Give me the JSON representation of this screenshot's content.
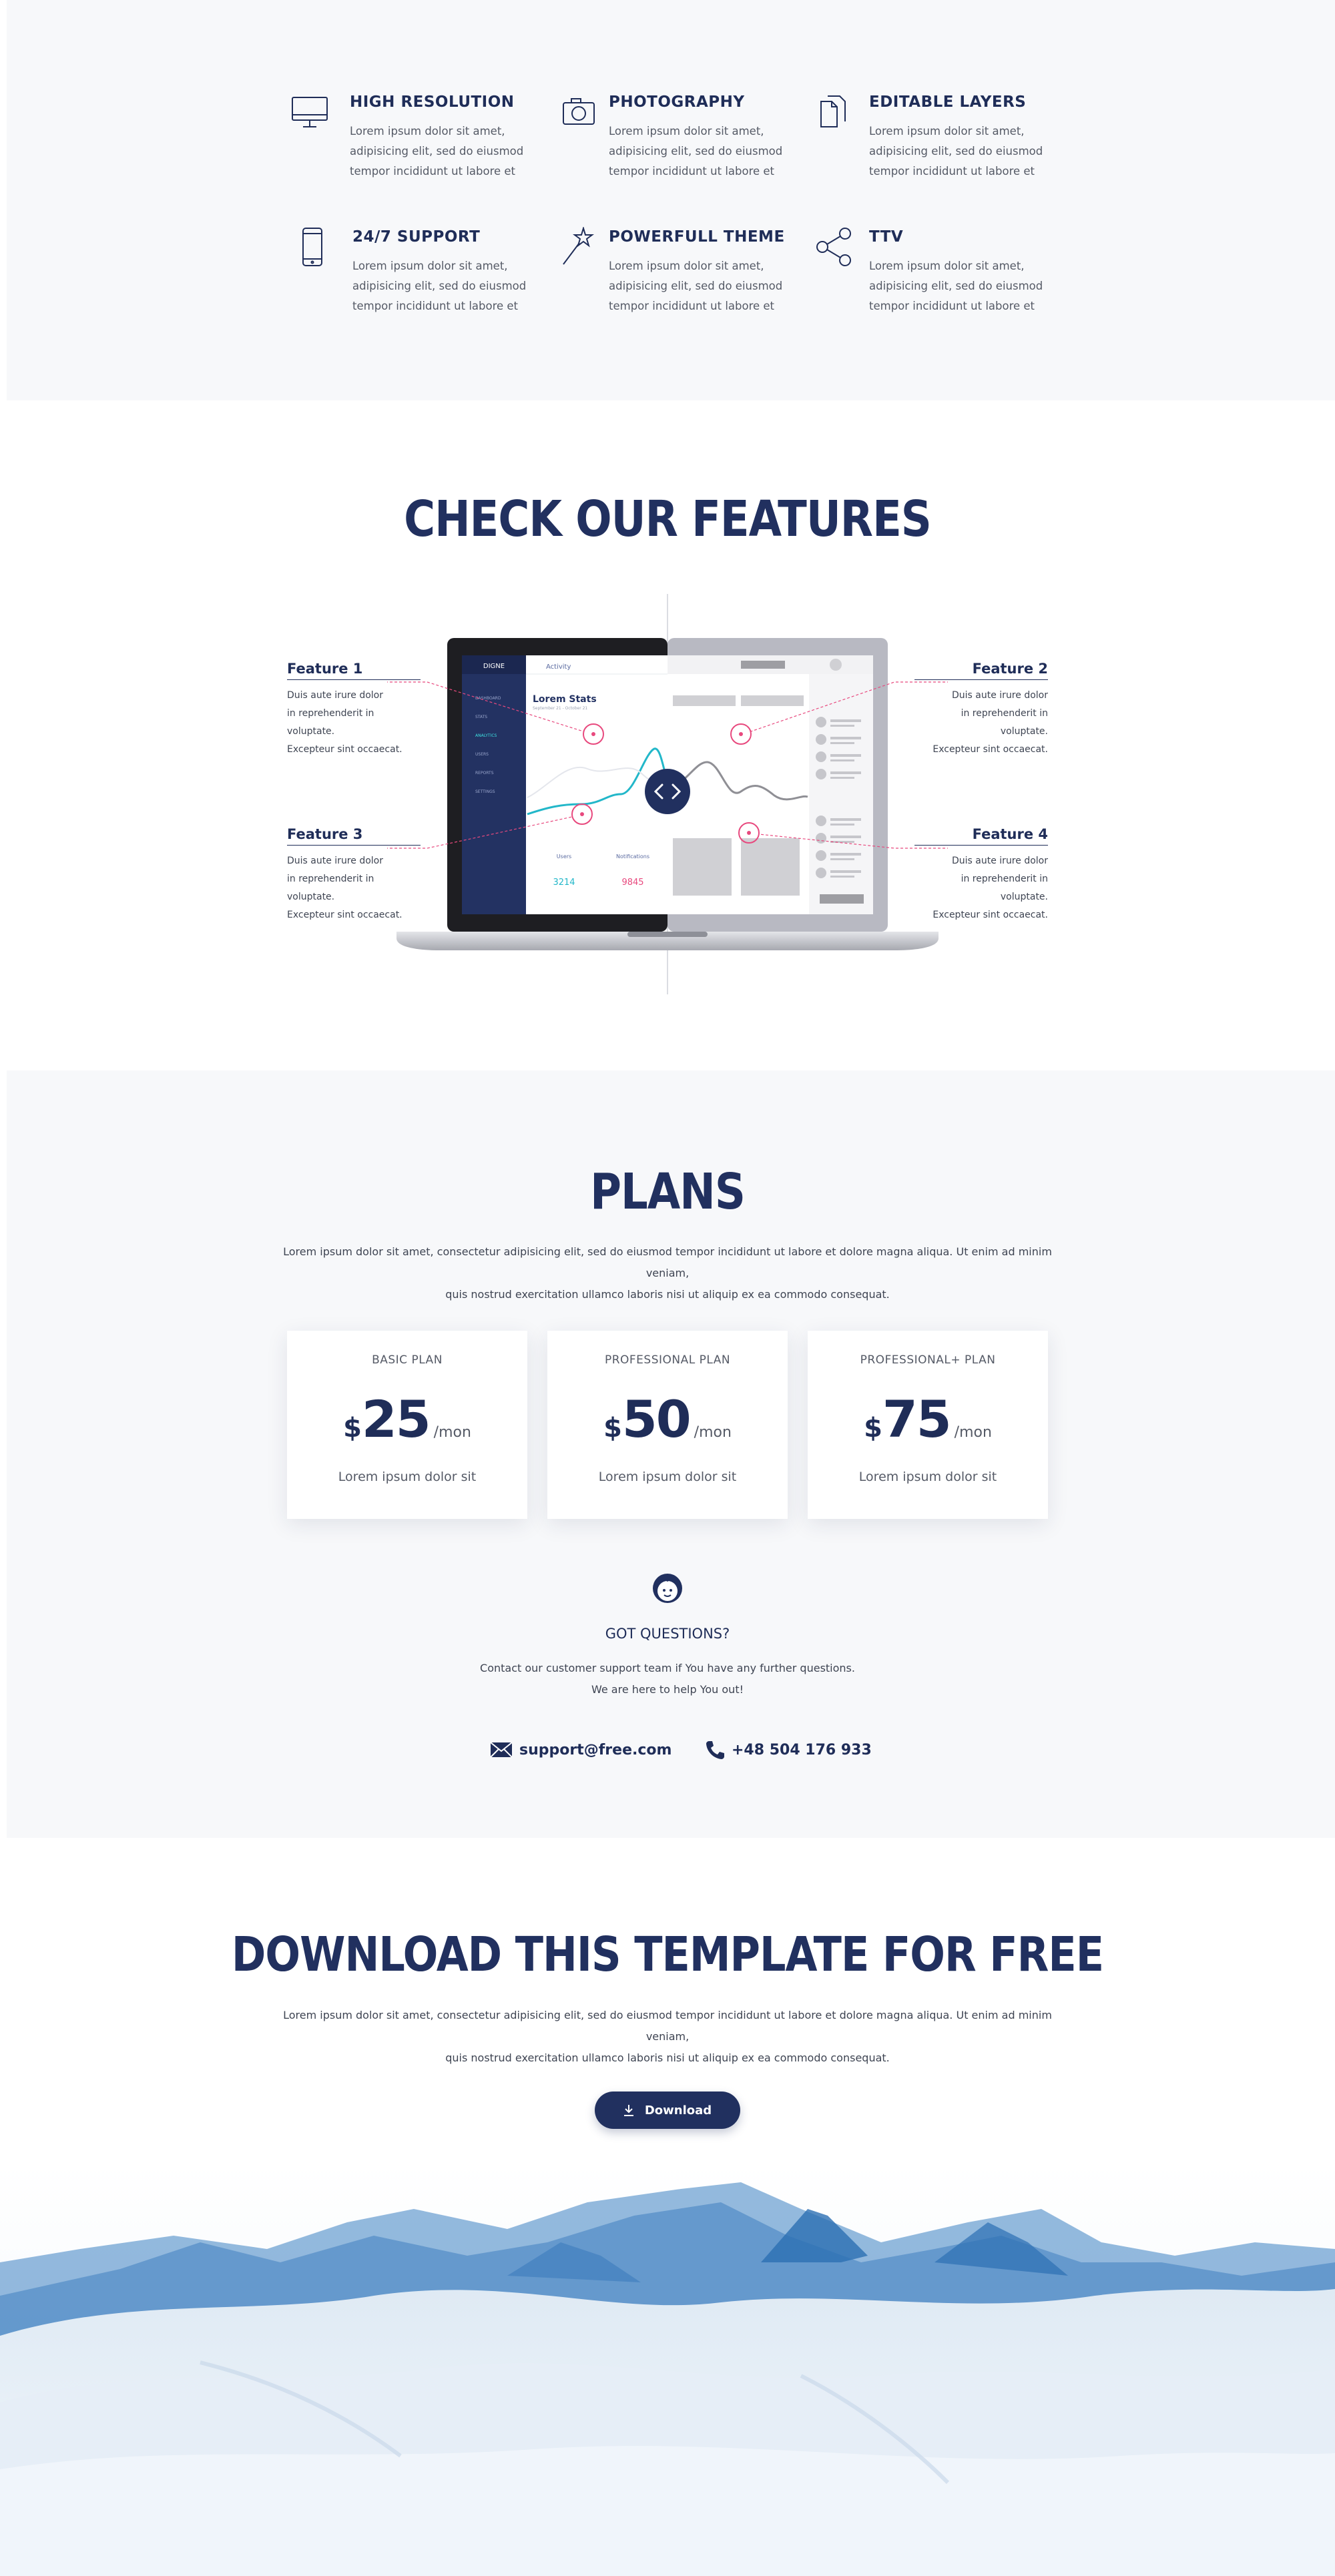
{
  "top_features": [
    {
      "icon": "monitor-icon",
      "title": "HIGH RESOLUTION",
      "text": "Lorem ipsum dolor sit amet, adipisicing elit, sed do eiusmod tempor incididunt ut labore et"
    },
    {
      "icon": "camera-icon",
      "title": "PHOTOGRAPHY",
      "text": "Lorem ipsum dolor sit amet, adipisicing elit, sed do eiusmod tempor incididunt ut labore et"
    },
    {
      "icon": "layers-icon",
      "title": "EDITABLE LAYERS",
      "text": "Lorem ipsum dolor sit amet, adipisicing elit, sed do eiusmod tempor incididunt ut labore et"
    },
    {
      "icon": "phone-icon",
      "title": "24/7 SUPPORT",
      "text": "Lorem ipsum dolor sit amet, adipisicing elit, sed do eiusmod tempor incididunt ut labore et"
    },
    {
      "icon": "magic-wand-icon",
      "title": "POWERFULL THEME",
      "text": "Lorem ipsum dolor sit amet, adipisicing elit, sed do eiusmod tempor incididunt ut labore et"
    },
    {
      "icon": "share-icon",
      "title": "TTV",
      "text": "Lorem ipsum dolor sit amet, adipisicing elit, sed do eiusmod tempor incididunt ut labore et"
    }
  ],
  "check_features": {
    "heading": "CHECK OUR FEATURES",
    "labels": [
      {
        "name": "Feature 1",
        "lines": [
          "Duis aute irure dolor",
          "in reprehenderit in voluptate.",
          "Excepteur sint occaecat."
        ]
      },
      {
        "name": "Feature 2",
        "lines": [
          "Duis aute irure dolor",
          "in reprehenderit in voluptate.",
          "Excepteur sint occaecat."
        ]
      },
      {
        "name": "Feature 3",
        "lines": [
          "Duis aute irure dolor",
          "in reprehenderit in voluptate.",
          "Excepteur sint occaecat."
        ]
      },
      {
        "name": "Feature 4",
        "lines": [
          "Duis aute irure dolor",
          "in reprehenderit in voluptate.",
          "Excepteur sint occaecat."
        ]
      }
    ],
    "screen": {
      "brand": "DIGNE",
      "tab": "Activity",
      "stats_title": "Lorem Stats",
      "stats_sub": "September 21 - October 21",
      "users_label": "Users",
      "users_value": "3214",
      "notif_label": "Notifications",
      "notif_value": "9845",
      "menu": [
        "DASHBOARD",
        "STATS",
        "ANALYTICS",
        "USERS",
        "REPORTS",
        "SETTINGS"
      ]
    },
    "colors": {
      "accent": "#e8497e",
      "teal": "#22b7c9",
      "navy": "#21305f"
    }
  },
  "plans": {
    "heading": "PLANS",
    "intro_line1": "Lorem ipsum dolor sit amet, consectetur adipisicing elit, sed do eiusmod tempor incididunt ut labore et dolore magna aliqua. Ut enim ad minim veniam,",
    "intro_line2": "quis nostrud exercitation ullamco laboris nisi ut aliquip ex ea commodo consequat.",
    "cards": [
      {
        "name": "BASIC PLAN",
        "currency": "$",
        "amount": "25",
        "period": "/mon",
        "desc": "Lorem ipsum dolor sit"
      },
      {
        "name": "PROFESSIONAL PLAN",
        "currency": "$",
        "amount": "50",
        "period": "/mon",
        "desc": "Lorem ipsum dolor sit"
      },
      {
        "name": "PROFESSIONAL+ PLAN",
        "currency": "$",
        "amount": "75",
        "period": "/mon",
        "desc": "Lorem ipsum dolor sit"
      }
    ],
    "questions": {
      "title": "GOT QUESTIONS?",
      "line1": "Contact our customer support team if You have any further questions.",
      "line2": "We are here to help You out!",
      "email": "support@free.com",
      "phone": "+48 504 176 933"
    }
  },
  "download": {
    "heading": "DOWNLOAD THIS TEMPLATE FOR FREE",
    "intro_line1": "Lorem ipsum dolor sit amet, consectetur adipisicing elit, sed do eiusmod tempor incididunt ut labore et dolore magna aliqua. Ut enim ad minim veniam,",
    "intro_line2": "quis nostrud exercitation ullamco laboris nisi ut aliquip ex ea commodo consequat.",
    "button_label": "Download"
  }
}
